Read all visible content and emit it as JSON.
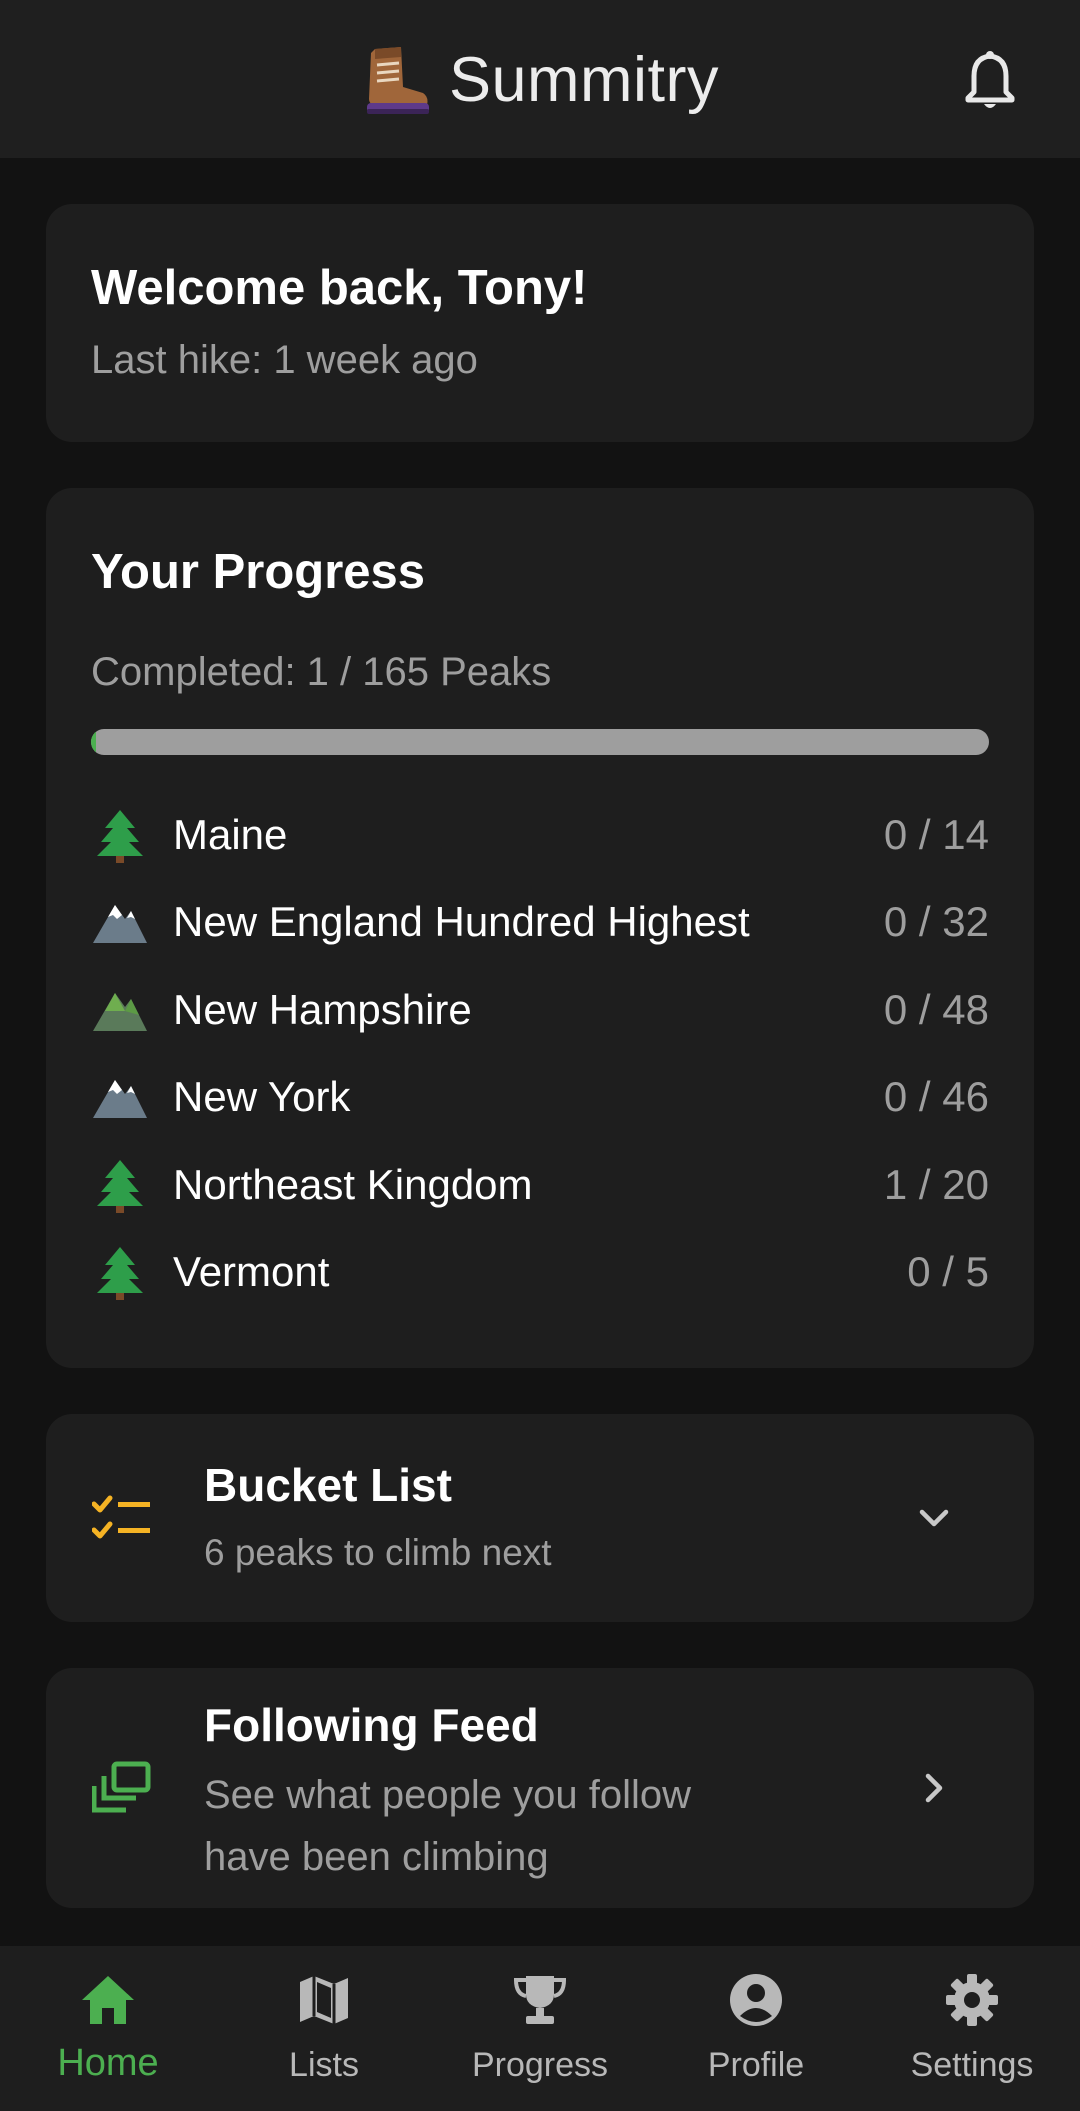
{
  "app": {
    "title": "Summitry"
  },
  "welcome": {
    "title": "Welcome back, Tony!",
    "subtitle": "Last hike: 1 week ago"
  },
  "progress": {
    "title": "Your Progress",
    "completed_text": "Completed: 1 / 165 Peaks",
    "completed": 1,
    "total": 165,
    "bar_fraction": 0.006,
    "colors": {
      "fill": "#4caf50",
      "track": "#9e9e9e"
    },
    "lists": [
      {
        "icon": "evergreen-tree-icon",
        "name": "Maine",
        "count": "0 / 14"
      },
      {
        "icon": "snow-capped-mountain-icon",
        "name": "New England Hundred Highest",
        "count": "0 / 32"
      },
      {
        "icon": "green-mountain-icon",
        "name": "New Hampshire",
        "count": "0 / 48"
      },
      {
        "icon": "snow-capped-mountain-icon",
        "name": "New York",
        "count": "0 / 46"
      },
      {
        "icon": "evergreen-tree-icon",
        "name": "Northeast Kingdom",
        "count": "1 / 20"
      },
      {
        "icon": "evergreen-tree-icon",
        "name": "Vermont",
        "count": "0 / 5"
      }
    ]
  },
  "bucket_list": {
    "title": "Bucket List",
    "subtitle": "6 peaks to climb next",
    "icon": "checklist-icon",
    "accent": "#f5b324"
  },
  "following_feed": {
    "title": "Following Feed",
    "subtitle_line1": "See what people you follow",
    "subtitle_line2": "have been climbing",
    "icon": "dynamic-feed-icon",
    "accent": "#4caf50"
  },
  "nav": {
    "active": "Home",
    "items": [
      {
        "label": "Home",
        "icon": "home-icon"
      },
      {
        "label": "Lists",
        "icon": "map-icon"
      },
      {
        "label": "Progress",
        "icon": "trophy-icon"
      },
      {
        "label": "Profile",
        "icon": "account-circle-icon"
      },
      {
        "label": "Settings",
        "icon": "gear-icon"
      }
    ]
  }
}
